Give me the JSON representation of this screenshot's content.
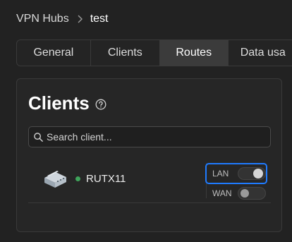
{
  "breadcrumb": {
    "root": "VPN Hubs",
    "current": "test"
  },
  "tabs": [
    {
      "label": "General",
      "active": false
    },
    {
      "label": "Clients",
      "active": false
    },
    {
      "label": "Routes",
      "active": true
    },
    {
      "label": "Data usa",
      "active": false
    }
  ],
  "panel": {
    "title": "Clients",
    "search": {
      "placeholder": "Search client...",
      "value": ""
    },
    "clients": [
      {
        "name": "RUTX11",
        "status": "online",
        "status_color": "#3fa45b",
        "toggles": [
          {
            "label": "LAN",
            "on": true,
            "highlighted": true
          },
          {
            "label": "WAN",
            "on": false
          }
        ]
      }
    ]
  },
  "colors": {
    "accent": "#1f7bff",
    "background": "#222222",
    "online": "#3fa45b"
  }
}
